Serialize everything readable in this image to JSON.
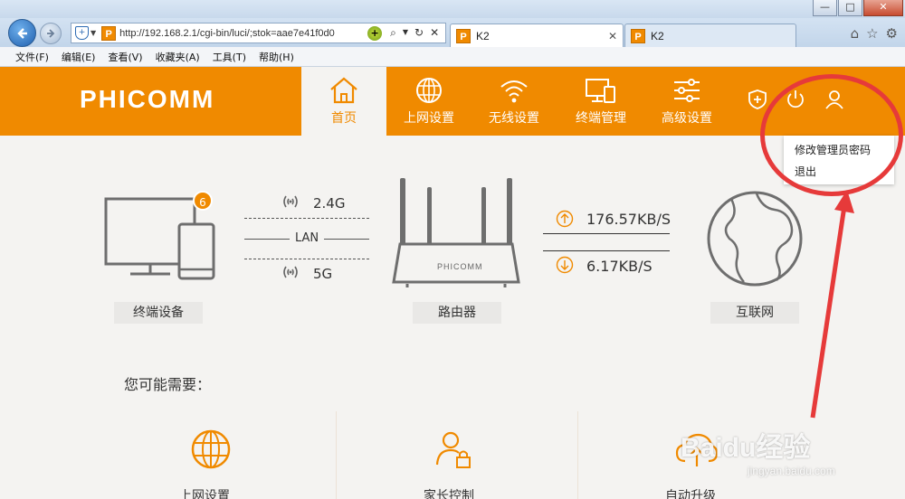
{
  "browser": {
    "window_buttons": {
      "minimize": "—",
      "maximize": "□",
      "close": "✕"
    },
    "address": "http://192.168.2.1/cgi-bin/luci/;stok=aae7e41f0d0",
    "tabs": [
      {
        "title": "K2",
        "close": "✕"
      },
      {
        "title": "K2"
      }
    ],
    "menu": [
      "文件(F)",
      "编辑(E)",
      "查看(V)",
      "收藏夹(A)",
      "工具(T)",
      "帮助(H)"
    ],
    "icons": [
      "home-icon",
      "star-icon",
      "gear-icon"
    ]
  },
  "router": {
    "logo": {
      "main": "PHICOMM"
    },
    "nav": [
      "首页",
      "上网设置",
      "无线设置",
      "终端管理",
      "高级设置"
    ],
    "dropdown": [
      "修改管理员密码",
      "退出"
    ],
    "accent_color": "#f08a00"
  },
  "topology": {
    "device_badge": "6",
    "devices_label": "终端设备",
    "router_label": "路由器",
    "internet_label": "互联网",
    "router_brand": "PHICOMM",
    "band_24": "2.4G",
    "lan": "LAN",
    "band_5": "5G",
    "upload": "176.57KB/S",
    "download": "6.17KB/S"
  },
  "needs": {
    "title": "您可能需要：",
    "items": [
      "上网设置",
      "家长控制",
      "自动升级"
    ]
  },
  "watermark": {
    "brand": "Baidu经验",
    "url": "jingyan.baidu.com"
  }
}
